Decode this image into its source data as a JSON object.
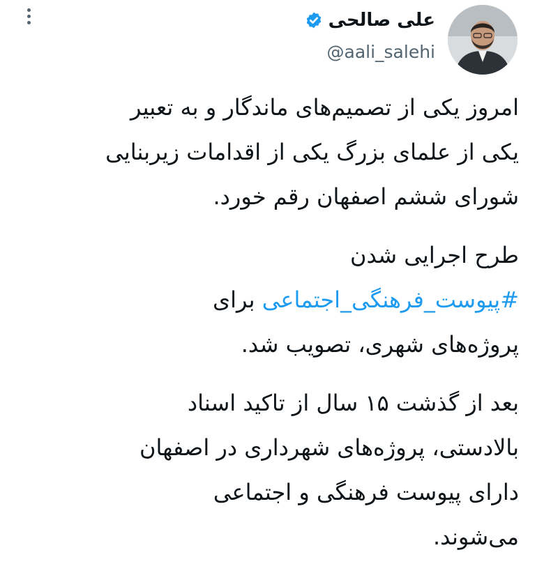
{
  "author": {
    "name": "علی صالحی",
    "handle": "@aali_salehi",
    "verified": true,
    "verified_color": "#1d9bf0"
  },
  "menu_icon": "more-vertical-icon",
  "tweet": {
    "p1": [
      "امروز یکی از تصمیم‌های ماندگار و به تعبیر",
      "یکی از علمای بزرگ یکی از اقدامات زیربنایی",
      "شورای ششم اصفهان رقم خورد."
    ],
    "p2_line1": "طرح اجرایی شدن",
    "hashtag": "#پیوست_فرهنگی_اجتماعی",
    "p2_line2_after": " برای",
    "p2_line3": "پروژه‌های شهری، تصویب شد.",
    "p3": [
      "بعد از گذشت ۱۵ سال از تاکید اسناد",
      "بالادستی، پروژه‌های شهرداری در اصفهان",
      "دارای پیوست فرهنگی و اجتماعی",
      "می‌شوند."
    ]
  }
}
